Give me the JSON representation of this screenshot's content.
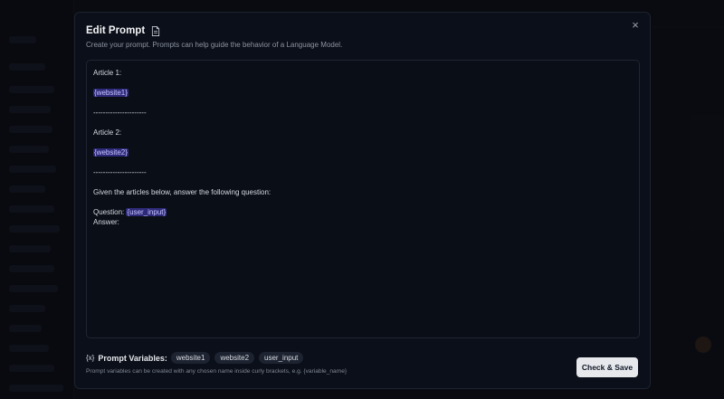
{
  "modal": {
    "title": "Edit Prompt",
    "subtitle": "Create your prompt. Prompts can help guide the behavior of a Language Model.",
    "close_icon": "×"
  },
  "editor": {
    "lines": [
      {
        "text": "Article 1:"
      },
      {
        "text": ""
      },
      {
        "var": "{website1}"
      },
      {
        "text": ""
      },
      {
        "text": "----------------------"
      },
      {
        "text": ""
      },
      {
        "text": "Article 2:"
      },
      {
        "text": ""
      },
      {
        "var": "{website2}"
      },
      {
        "text": ""
      },
      {
        "text": "----------------------"
      },
      {
        "text": ""
      },
      {
        "text": "Given the articles below, answer the following question:"
      },
      {
        "text": ""
      },
      {
        "text": "Question: ",
        "var": "{user_input}"
      },
      {
        "text": "Answer:"
      }
    ]
  },
  "variables": {
    "label": "Prompt Variables:",
    "icon": "{x}",
    "items": [
      "website1",
      "website2",
      "user_input"
    ],
    "hint": "Prompt variables can be created with any chosen name inside curly brackets, e.g. {variable_name}"
  },
  "actions": {
    "save_label": "Check & Save"
  }
}
